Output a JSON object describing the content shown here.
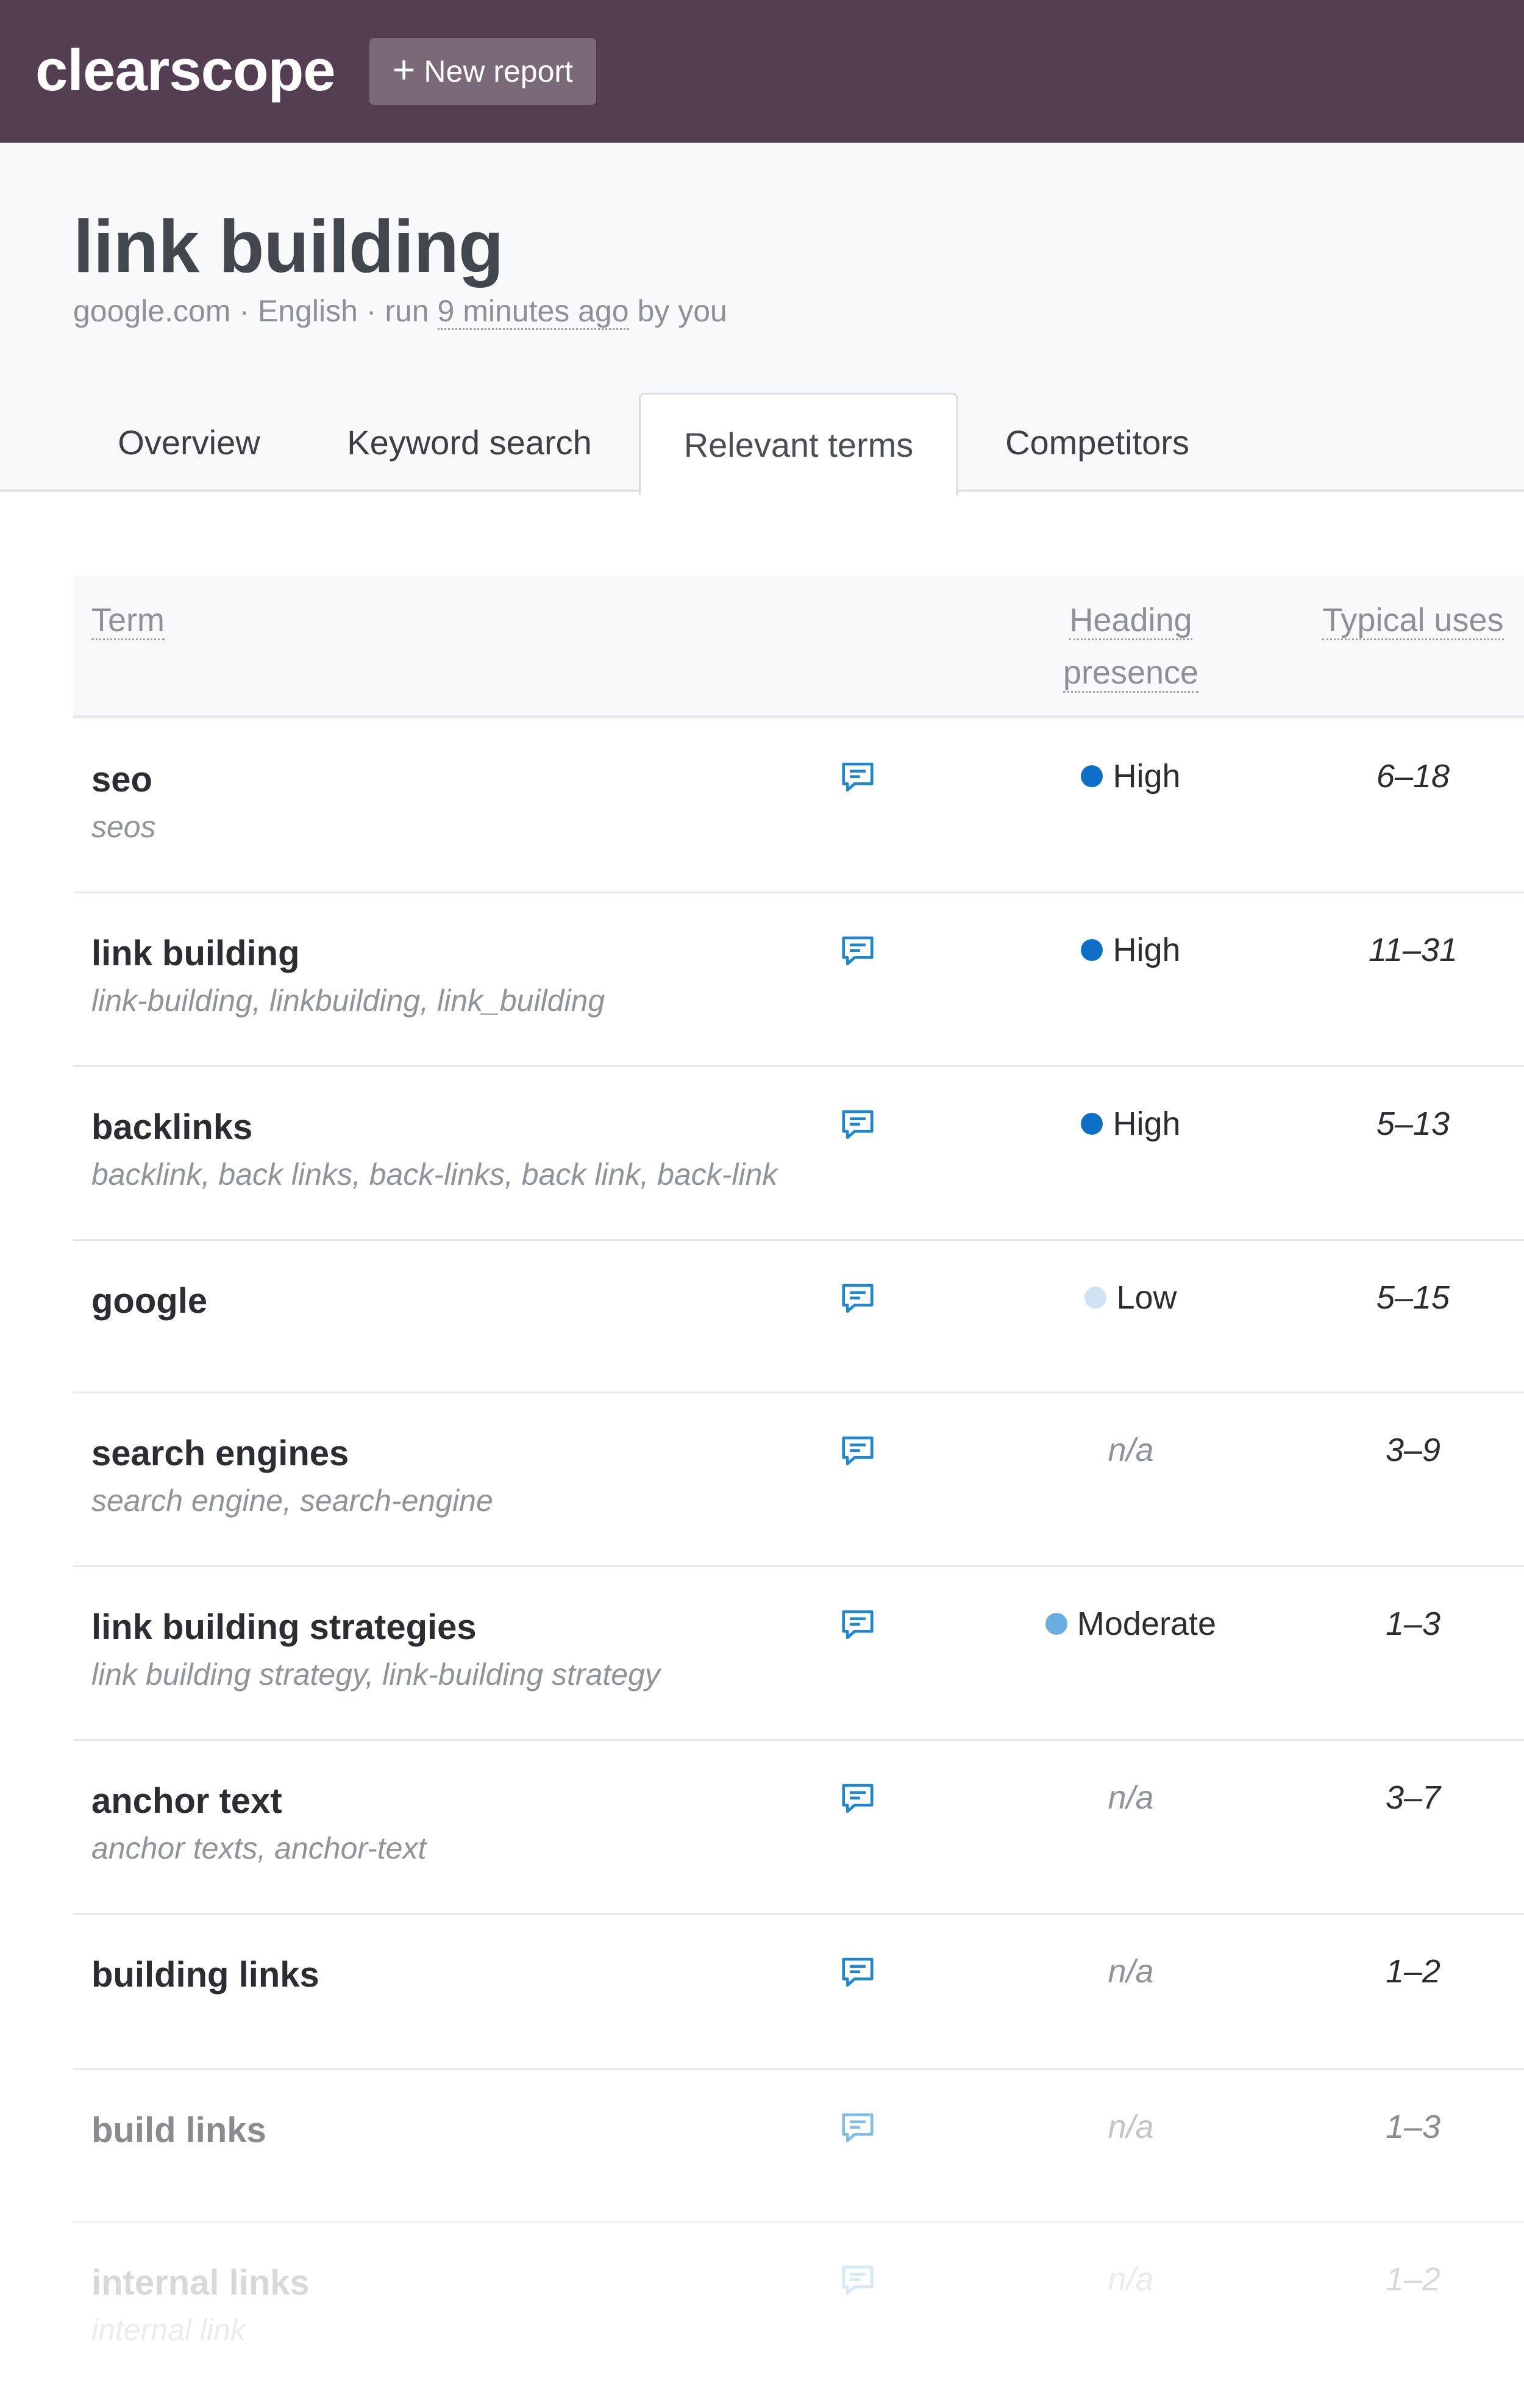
{
  "app": {
    "logo": "clearscope",
    "new_report": "New report",
    "new_report_icon": "plus-icon"
  },
  "report": {
    "title": "link building",
    "meta_prefix": "google.com · English · run ",
    "meta_time": "9 minutes ago",
    "meta_suffix": " by you"
  },
  "tabs": [
    {
      "label": "Overview",
      "active": false
    },
    {
      "label": "Keyword search",
      "active": false
    },
    {
      "label": "Relevant terms",
      "active": true
    },
    {
      "label": "Competitors",
      "active": false
    }
  ],
  "table": {
    "headers": {
      "term": "Term",
      "heading_presence_line1": "Heading",
      "heading_presence_line2": "presence",
      "typical_uses": "Typical uses"
    },
    "note_icon": "comment-icon",
    "rows": [
      {
        "term": "seo",
        "variants": "seos",
        "presence": "High",
        "presence_color": "#0e6fc7",
        "uses": "6–18"
      },
      {
        "term": "link building",
        "variants": "link-building, linkbuilding, link_building",
        "presence": "High",
        "presence_color": "#0e6fc7",
        "uses": "11–31"
      },
      {
        "term": "backlinks",
        "variants": "backlink, back links, back-links, back link, back-link",
        "presence": "High",
        "presence_color": "#0e6fc7",
        "uses": "5–13"
      },
      {
        "term": "google",
        "variants": "",
        "presence": "Low",
        "presence_color": "#cfe3f2",
        "uses": "5–15"
      },
      {
        "term": "search engines",
        "variants": "search engine, search-engine",
        "presence": "n/a",
        "presence_color": "",
        "uses": "3–9"
      },
      {
        "term": "link building strategies",
        "variants": "link building strategy, link-building strategy",
        "presence": "Moderate",
        "presence_color": "#6aaedf",
        "uses": "1–3"
      },
      {
        "term": "anchor text",
        "variants": "anchor texts, anchor-text",
        "presence": "n/a",
        "presence_color": "",
        "uses": "3–7"
      },
      {
        "term": "building links",
        "variants": "",
        "presence": "n/a",
        "presence_color": "",
        "uses": "1–2"
      },
      {
        "term": "build links",
        "variants": "",
        "presence": "n/a",
        "presence_color": "",
        "uses": "1–3"
      },
      {
        "term": "internal links",
        "variants": "internal link",
        "presence": "n/a",
        "presence_color": "",
        "uses": "1–2"
      }
    ]
  },
  "colors": {
    "topbar": "#533f51",
    "accent_blue": "#0e6fc7",
    "note_icon": "#1f86d0"
  }
}
